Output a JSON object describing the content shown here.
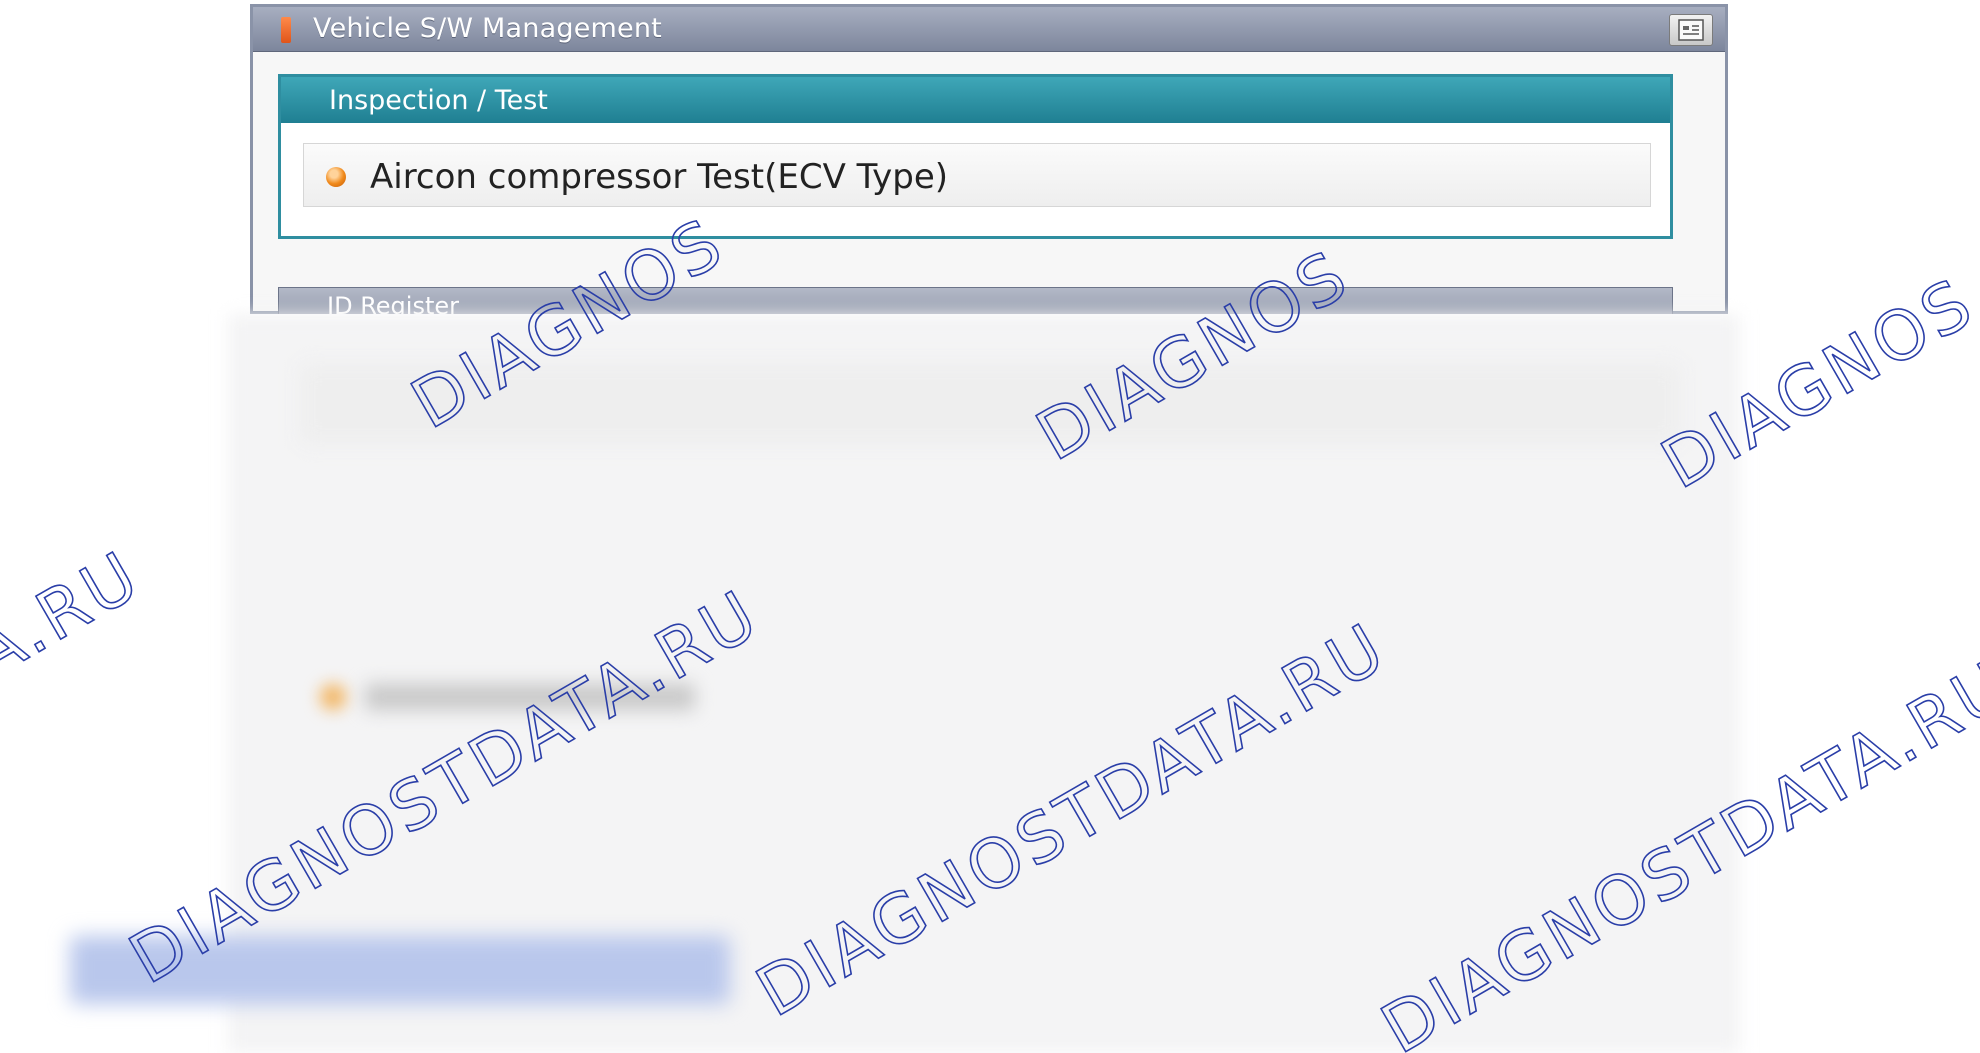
{
  "window": {
    "title": "Vehicle S/W Management"
  },
  "inspection_panel": {
    "header": "Inspection / Test",
    "items": [
      {
        "label": "Aircon compressor Test(ECV Type)"
      }
    ]
  },
  "register_panel": {
    "header": "ID Register"
  },
  "watermark": {
    "text_top": "DIAGNOS",
    "text_main": "DIAGNOSTDATA.RU",
    "text_tail": "A.RU",
    "color": "#2a3ea8"
  }
}
